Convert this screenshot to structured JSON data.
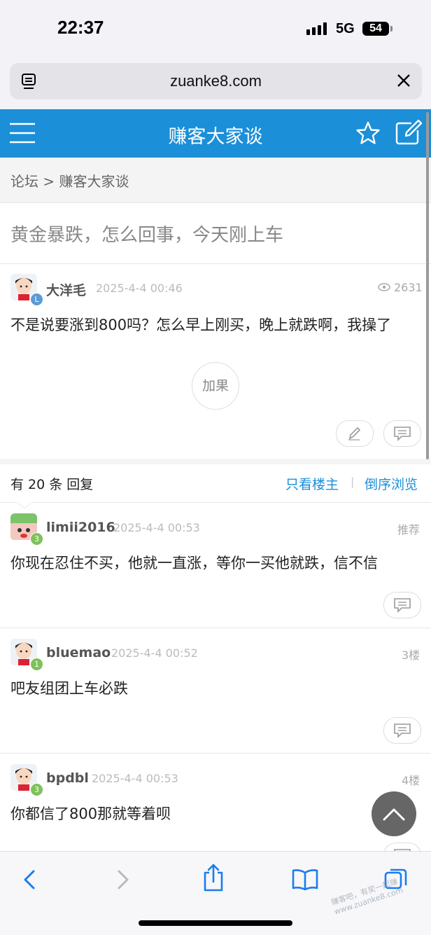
{
  "status_bar": {
    "time": "22:37",
    "network": "5G",
    "battery": "54"
  },
  "browser": {
    "url": "zuanke8.com"
  },
  "header": {
    "title": "赚客大家谈"
  },
  "breadcrumb": "论坛 > 赚客大家谈",
  "thread": {
    "title": "黄金暴跌，怎么回事，今天刚上车",
    "author": "大洋毛",
    "level": "L",
    "date": "2025-4-4 00:46",
    "views": "2631",
    "body": "不是说要涨到800吗？怎么早上刚买，晚上就跌啊，我操了",
    "praise_label": "加果"
  },
  "reply_bar": {
    "count_text": "有 20 条 回复",
    "only_author": "只看楼主",
    "separator": "|",
    "reverse": "倒序浏览"
  },
  "replies": [
    {
      "author": "limii2016",
      "level": "3",
      "date": "2025-4-4 00:53",
      "floor": "推荐",
      "body": "你现在忍住不买，他就一直涨，等你一买他就跌，信不信"
    },
    {
      "author": "bluemao",
      "level": "1",
      "date": "2025-4-4 00:52",
      "floor": "3楼",
      "body": "吧友组团上车必跌"
    },
    {
      "author": "bpdbl",
      "level": "3",
      "date": "2025-4-4 00:53",
      "floor": "4楼",
      "body": "你都信了800那就等着呗"
    }
  ],
  "watermark": "赚客吧，有奖一起赚 www.zuanke8.com",
  "colors": {
    "brand": "#1b8fd8",
    "level_green": "#7dc25a",
    "level_blue": "#5b9bd5"
  },
  "icons": {
    "header": [
      "menu-icon",
      "star-icon",
      "edit-icon"
    ],
    "toolbar": [
      "back-icon",
      "forward-icon",
      "share-icon",
      "bookmarks-icon",
      "tabs-icon"
    ]
  }
}
